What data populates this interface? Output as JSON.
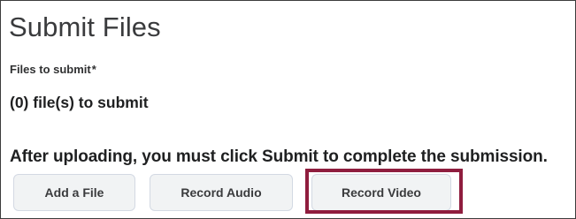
{
  "heading": "Submit Files",
  "files_label": "Files to submit",
  "required_marker": "*",
  "file_count_text": "(0) file(s) to submit",
  "instruction_text": "After uploading, you must click Submit to complete the submission.",
  "buttons": {
    "add_file": "Add a File",
    "record_audio": "Record Audio",
    "record_video": "Record Video"
  },
  "highlight_color": "#8f1d3e"
}
